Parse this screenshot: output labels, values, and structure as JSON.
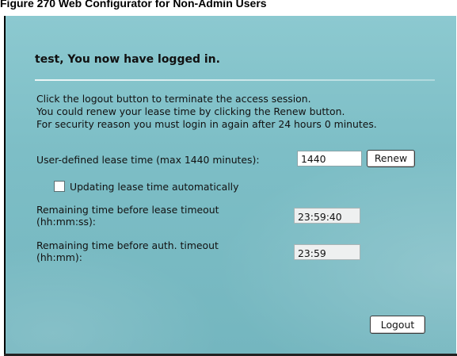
{
  "caption": "Figure 270   Web Configurator for Non-Admin Users",
  "title": "test, You now have logged in.",
  "info_lines": [
    "Click the logout button to terminate the access session.",
    "You could renew your lease time by clicking the Renew button.",
    "For security reason you must login in again after 24 hours 0 minutes."
  ],
  "lease": {
    "label": "User-defined lease time (max 1440 minutes):",
    "value": "1440",
    "renew_label": "Renew"
  },
  "auto_update": {
    "label": "Updating lease time automatically",
    "checked": false
  },
  "remaining_lease": {
    "label_line1": "Remaining time before lease timeout",
    "label_line2": "(hh:mm:ss):",
    "value": "23:59:40"
  },
  "remaining_auth": {
    "label_line1": "Remaining time before auth. timeout",
    "label_line2": "(hh:mm):",
    "value": "23:59"
  },
  "logout_label": "Logout"
}
